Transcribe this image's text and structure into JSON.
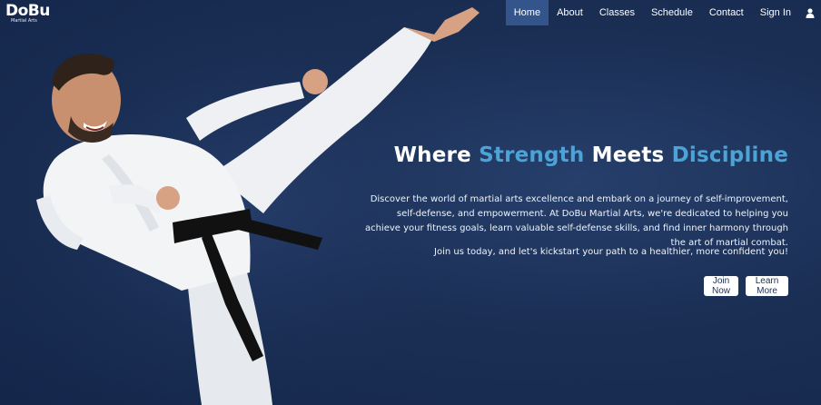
{
  "brand": {
    "logo_text": "DoBu",
    "logo_subtext": "Martial Arts"
  },
  "nav": {
    "items": [
      {
        "label": "Home",
        "active": true
      },
      {
        "label": "About",
        "active": false
      },
      {
        "label": "Classes",
        "active": false
      },
      {
        "label": "Schedule",
        "active": false
      },
      {
        "label": "Contact",
        "active": false
      },
      {
        "label": "Sign In",
        "active": false
      }
    ],
    "user_icon": "user-icon"
  },
  "hero": {
    "headline_parts": [
      "Where ",
      "Strength",
      " Meets ",
      "Discipline"
    ],
    "paragraph1": "Discover the world of martial arts excellence and embark on a journey of self-improvement, self-defense, and empowerment. At DoBu Martial Arts, we're dedicated to helping you achieve your fitness goals, learn valuable self-defense skills, and find inner harmony through the art of martial combat.",
    "paragraph2": "Join us today, and let's kickstart your path to a healthier, more confident you!",
    "buttons": {
      "join": "Join Now",
      "learn": "Learn More"
    }
  },
  "colors": {
    "background": "#1b2f55",
    "accent": "#4ba3d6",
    "nav_active": "#34558c",
    "button_text": "#1b2f55"
  }
}
